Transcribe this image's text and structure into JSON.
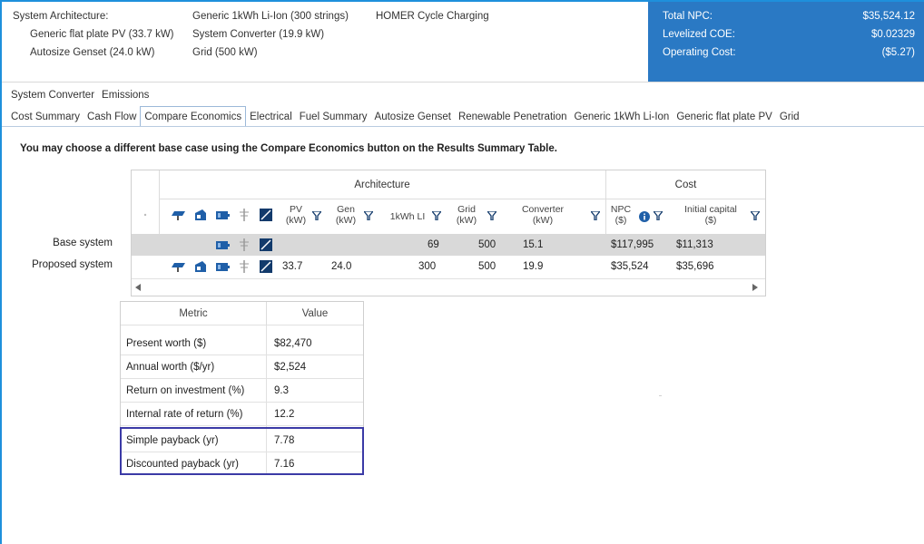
{
  "header": {
    "system_architecture_label": "System Architecture:",
    "arch_items": [
      "Generic 1kWh Li-Ion (300 strings)",
      "HOMER Cycle Charging",
      "Generic flat plate PV (33.7 kW)",
      "System Converter (19.9 kW)",
      "Autosize Genset (24.0 kW)",
      "Grid (500 kW)"
    ],
    "summary": [
      {
        "label": "Total NPC:",
        "value": "$35,524.12"
      },
      {
        "label": "Levelized COE:",
        "value": "$0.02329"
      },
      {
        "label": "Operating Cost:",
        "value": "($5.27)"
      }
    ],
    "summary_bg": "#2a79c4"
  },
  "tabs": {
    "row1": [
      "System Converter",
      "Emissions"
    ],
    "row2": [
      "Cost Summary",
      "Cash Flow",
      "Compare Economics",
      "Electrical",
      "Fuel Summary",
      "Autosize Genset",
      "Renewable Penetration",
      "Generic 1kWh Li-Ion",
      "Generic flat plate PV",
      "Grid"
    ],
    "active": "Compare Economics"
  },
  "note": "You may choose a different base case using the Compare Economics button on the Results Summary Table.",
  "comparison": {
    "groups": [
      "Architecture",
      "Cost"
    ],
    "columns": [
      {
        "l1": "PV",
        "l2": "(kW)"
      },
      {
        "l1": "Gen",
        "l2": "(kW)"
      },
      {
        "l1": "1kWh LI",
        "l2": ""
      },
      {
        "l1": "Grid",
        "l2": "(kW)"
      },
      {
        "l1": "Converter",
        "l2": "(kW)"
      },
      {
        "l1": "NPC",
        "l2": "($)"
      },
      {
        "l1": "Initial capital",
        "l2": "($)"
      }
    ],
    "row_labels": [
      "Base system",
      "Proposed system"
    ],
    "base": {
      "pv": "",
      "gen": "",
      "li": "69",
      "grid": "500",
      "conv": "15.1",
      "npc": "$117,995",
      "capital": "$11,313"
    },
    "proposed": {
      "pv": "33.7",
      "gen": "24.0",
      "li": "300",
      "grid": "500",
      "conv": "19.9",
      "npc": "$35,524",
      "capital": "$35,696"
    }
  },
  "metrics": {
    "headers": [
      "Metric",
      "Value"
    ],
    "rows": [
      {
        "metric": "Present worth ($)",
        "value": "$82,470"
      },
      {
        "metric": "Annual worth ($/yr)",
        "value": "$2,524"
      },
      {
        "metric": "Return on investment (%)",
        "value": "9.3"
      },
      {
        "metric": "Internal rate of return (%)",
        "value": "12.2"
      },
      {
        "metric": "Simple payback (yr)",
        "value": "7.78"
      },
      {
        "metric": "Discounted payback (yr)",
        "value": "7.16"
      }
    ],
    "highlight_color": "#3b3aa6"
  }
}
